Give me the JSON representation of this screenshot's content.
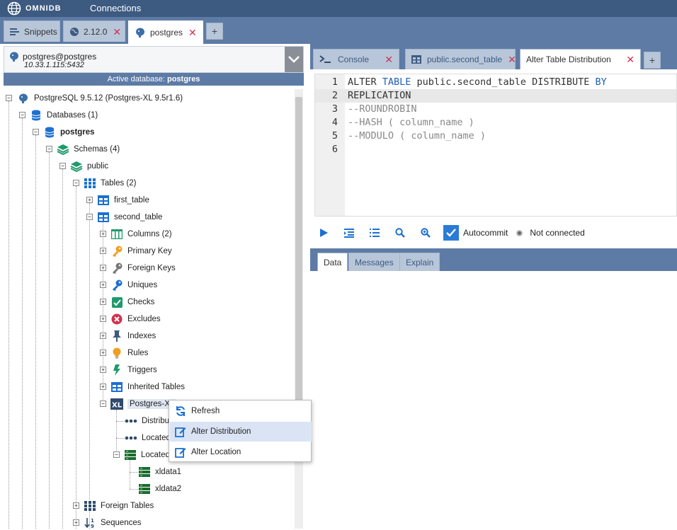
{
  "topbar": {
    "logo_text": "OMNIDB",
    "nav_connections": "Connections"
  },
  "outer_tabs": [
    {
      "label": "Snippets",
      "icon": "snippets-icon"
    },
    {
      "label": "2.12.0",
      "icon": "globe-icon",
      "close": "✕"
    },
    {
      "label": "postgres",
      "icon": "postgres-icon",
      "close": "✕",
      "active": true
    }
  ],
  "add_tab": "+",
  "connection": {
    "name": "postgres@postgres",
    "host": "10.33.1.115:5432"
  },
  "active_db": {
    "prefix": "Active database:",
    "name": "postgres"
  },
  "tree": {
    "server": "PostgreSQL 9.5.12 (Postgres-XL 9.5r1.6)",
    "databases": "Databases (1)",
    "db": "postgres",
    "schemas": "Schemas (4)",
    "schema": "public",
    "tables": "Tables (2)",
    "table1": "first_table",
    "table2": "second_table",
    "columns": "Columns (2)",
    "primary_key": "Primary Key",
    "foreign_keys": "Foreign Keys",
    "uniques": "Uniques",
    "checks": "Checks",
    "excludes": "Excludes",
    "indexes": "Indexes",
    "rules": "Rules",
    "triggers": "Triggers",
    "inherited": "Inherited Tables",
    "postgres_xl": "Postgres-XL",
    "distrib": "Distribu",
    "located1": "Located",
    "located2": "Located",
    "xldata1": "xldata1",
    "xldata2": "xldata2",
    "foreign_tables": "Foreign Tables",
    "sequences": "Sequences"
  },
  "inner_tabs": [
    {
      "label": "Console",
      "icon": "console-icon",
      "close": "✕"
    },
    {
      "label": "public.second_table",
      "icon": "table-icon",
      "close": "✕"
    },
    {
      "label": "Alter Table Distribution",
      "close": "✕",
      "active": true
    }
  ],
  "editor": {
    "lines": [
      {
        "n": "1"
      },
      {
        "n": "2"
      },
      {
        "n": "3"
      },
      {
        "n": "4"
      },
      {
        "n": "5"
      },
      {
        "n": "6"
      }
    ],
    "l1a": "ALTER ",
    "l1b": "TABLE",
    "l1c": " public.second_table DISTRIBUTE ",
    "l1d": "BY",
    "l2": "REPLICATION",
    "l3": "--ROUNDROBIN",
    "l4": "--HASH ( column_name )",
    "l5": "--MODULO ( column_name )"
  },
  "toolbar": {
    "autocommit": "Autocommit",
    "status": "Not connected"
  },
  "result_tabs": [
    {
      "label": "Data",
      "active": true
    },
    {
      "label": "Messages"
    },
    {
      "label": "Explain"
    }
  ],
  "context_menu": [
    {
      "label": "Refresh",
      "icon": "refresh-icon"
    },
    {
      "label": "Alter Distribution",
      "icon": "edit-icon",
      "hover": true
    },
    {
      "label": "Alter Location",
      "icon": "edit-icon"
    }
  ],
  "colors": {
    "topbar": "#3d5a80",
    "tabstrip": "#5d7ba5",
    "accent": "#2b7bd6",
    "close": "#d0324e"
  }
}
